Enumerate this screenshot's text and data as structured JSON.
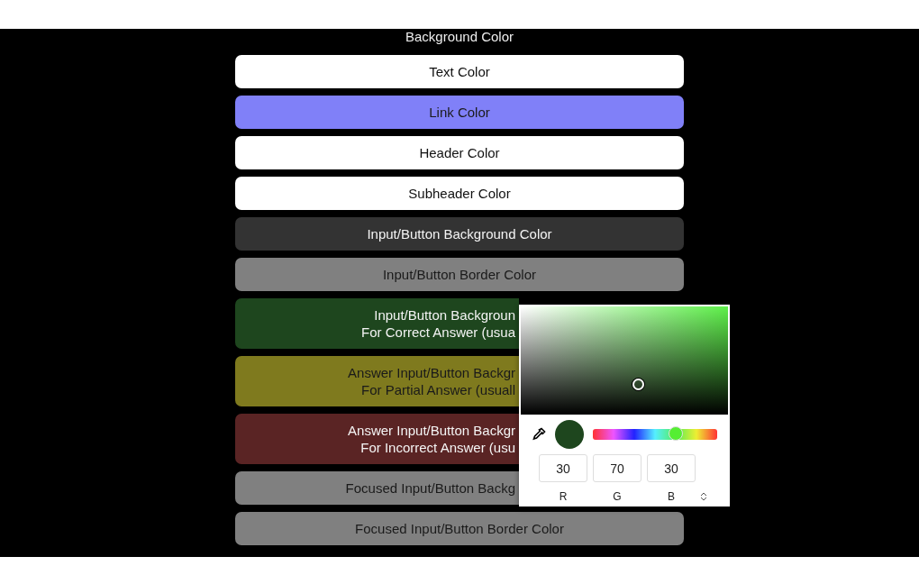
{
  "heading": "Background Color",
  "color_buttons": [
    {
      "kind": "full",
      "lines": [
        "Text Color"
      ],
      "color": "#ffffff"
    },
    {
      "kind": "full",
      "lines": [
        "Link Color"
      ],
      "color": "#8080f8"
    },
    {
      "kind": "full",
      "lines": [
        "Header Color"
      ],
      "color": "#ffffff"
    },
    {
      "kind": "full",
      "lines": [
        "Subheader Color"
      ],
      "color": "#ffffff"
    },
    {
      "kind": "full",
      "lines": [
        "Input/Button Background Color"
      ],
      "color": "#333333"
    },
    {
      "kind": "full",
      "lines": [
        "Input/Button Border Color"
      ],
      "color": "#808080"
    },
    {
      "kind": "covered",
      "lines": [
        "Input/Button Backgroun",
        "For Correct Answer (usua"
      ],
      "color": "#1e461e"
    },
    {
      "kind": "covered",
      "lines": [
        "Answer Input/Button Backgr",
        "For Partial Answer (usuall"
      ],
      "color": "#7f7a1e"
    },
    {
      "kind": "covered",
      "lines": [
        "Answer Input/Button Backgr",
        "For Incorrect Answer (usu"
      ],
      "color": "#5a2424"
    },
    {
      "kind": "covered",
      "lines": [
        "Focused Input/Button Backg"
      ],
      "color": "#808080"
    },
    {
      "kind": "full",
      "lines": [
        "Focused Input/Button Border Color"
      ],
      "color": "#808080"
    }
  ],
  "color_picker": {
    "swatch": {
      "color": "#1e461e"
    },
    "hue": {
      "level": 0.67
    },
    "fields": [
      {
        "label": "R",
        "value": "30"
      },
      {
        "label": "G",
        "value": "70"
      },
      {
        "label": "B",
        "value": "30"
      }
    ]
  }
}
